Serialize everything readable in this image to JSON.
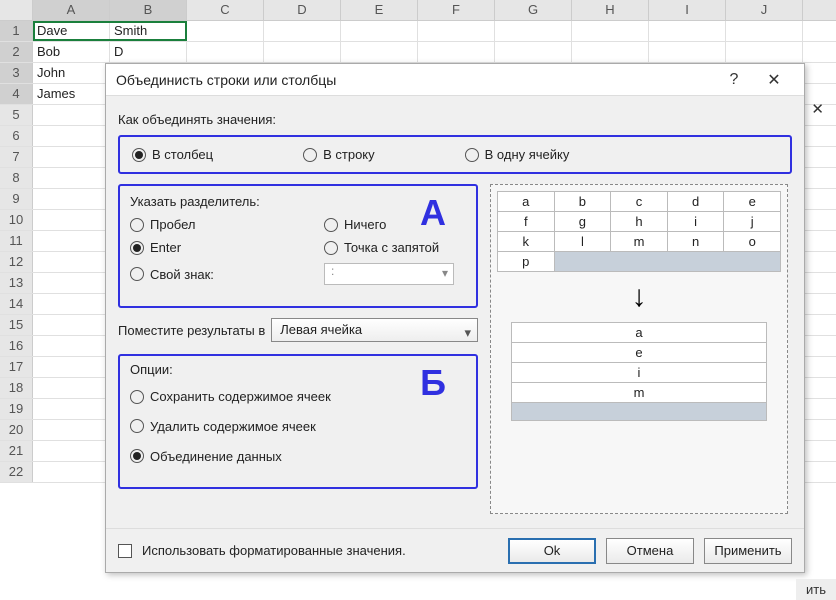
{
  "sheet": {
    "cols": [
      "A",
      "B",
      "C",
      "D",
      "E",
      "F",
      "G",
      "H",
      "I",
      "J"
    ],
    "rows": [
      "1",
      "2",
      "3",
      "4",
      "5",
      "6",
      "7",
      "8",
      "9",
      "10",
      "11",
      "12",
      "13",
      "14",
      "15",
      "16",
      "17",
      "18",
      "19",
      "20",
      "21",
      "22"
    ],
    "data": {
      "A1": "Dave",
      "B1": "Smith",
      "A2": "Bob",
      "A3": "John",
      "A4": "James"
    },
    "partial_b2": "D"
  },
  "dialog": {
    "title": "Объединисть строки или столбцы",
    "help": "?",
    "close": "✕",
    "how_label": "Как объединять значения:",
    "modes": {
      "col": "В столбец",
      "row": "В строку",
      "one": "В одну ячейку"
    },
    "sep": {
      "title": "Указать разделитель:",
      "space": "Пробел",
      "nothing": "Ничего",
      "enter": "Enter",
      "semi": "Точка с запятой",
      "custom": "Свой знак:",
      "custom_val": ":"
    },
    "letterA": "А",
    "letterB": "Б",
    "place": {
      "label": "Поместите результаты в",
      "selected": "Левая ячейка"
    },
    "options": {
      "title": "Опции:",
      "keep": "Сохранить содержимое ячеек",
      "del": "Удалить содержимое ячеек",
      "merge": "Объединение данных"
    },
    "preview": {
      "src_rows": [
        [
          "a",
          "b",
          "c",
          "d",
          "e"
        ],
        [
          "f",
          "g",
          "h",
          "i",
          "j"
        ],
        [
          "k",
          "l",
          "m",
          "n",
          "o"
        ],
        [
          "p"
        ]
      ],
      "result": [
        "a",
        "e",
        "i",
        "m"
      ]
    },
    "footer": {
      "formatted": "Использовать форматированные значения.",
      "ok": "Ok",
      "cancel": "Отмена",
      "apply": "Применить"
    }
  },
  "stray": {
    "ith": "ить"
  }
}
